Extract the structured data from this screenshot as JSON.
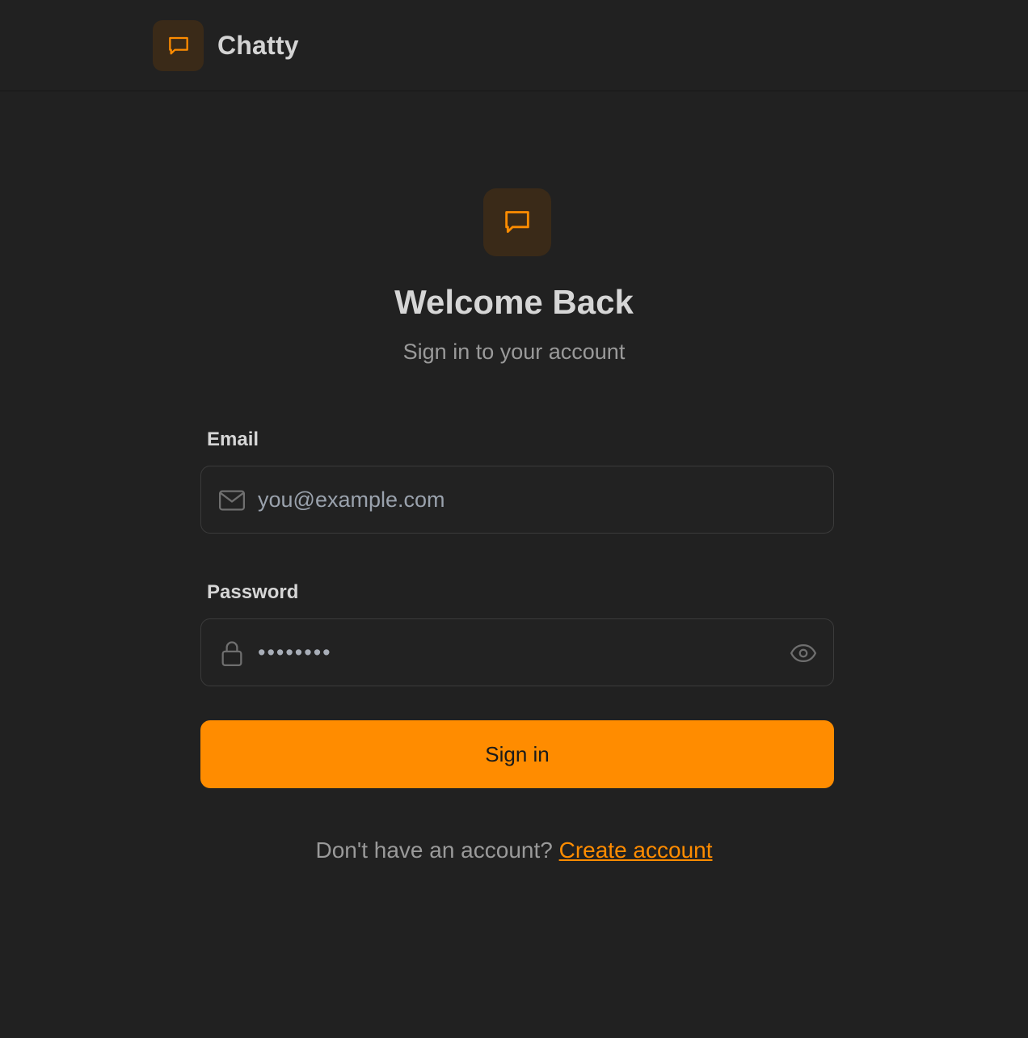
{
  "brand": {
    "name": "Chatty",
    "icon": "message-square-icon",
    "accent_color": "#ff8c00",
    "icon_bg_color": "#3a2a18"
  },
  "login": {
    "title": "Welcome Back",
    "subtitle": "Sign in to your account",
    "email": {
      "label": "Email",
      "placeholder": "you@example.com",
      "value": "",
      "icon": "mail-icon"
    },
    "password": {
      "label": "Password",
      "value": "••••••••",
      "icon": "lock-icon",
      "toggle_icon": "eye-icon"
    },
    "submit_label": "Sign in",
    "footer": {
      "prompt": "Don't have an account?",
      "link_label": "Create account"
    }
  },
  "colors": {
    "background": "#212121",
    "button": "#ff8c00",
    "text_primary": "#d6d6d6",
    "text_muted": "#9a9a9a"
  }
}
